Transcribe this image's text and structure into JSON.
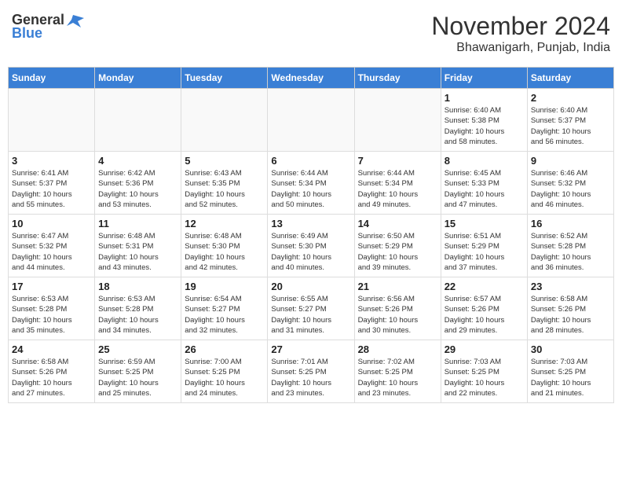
{
  "header": {
    "logo_general": "General",
    "logo_blue": "Blue",
    "month_title": "November 2024",
    "location": "Bhawanigarh, Punjab, India"
  },
  "weekdays": [
    "Sunday",
    "Monday",
    "Tuesday",
    "Wednesday",
    "Thursday",
    "Friday",
    "Saturday"
  ],
  "weeks": [
    [
      {
        "day": "",
        "info": ""
      },
      {
        "day": "",
        "info": ""
      },
      {
        "day": "",
        "info": ""
      },
      {
        "day": "",
        "info": ""
      },
      {
        "day": "",
        "info": ""
      },
      {
        "day": "1",
        "info": "Sunrise: 6:40 AM\nSunset: 5:38 PM\nDaylight: 10 hours\nand 58 minutes."
      },
      {
        "day": "2",
        "info": "Sunrise: 6:40 AM\nSunset: 5:37 PM\nDaylight: 10 hours\nand 56 minutes."
      }
    ],
    [
      {
        "day": "3",
        "info": "Sunrise: 6:41 AM\nSunset: 5:37 PM\nDaylight: 10 hours\nand 55 minutes."
      },
      {
        "day": "4",
        "info": "Sunrise: 6:42 AM\nSunset: 5:36 PM\nDaylight: 10 hours\nand 53 minutes."
      },
      {
        "day": "5",
        "info": "Sunrise: 6:43 AM\nSunset: 5:35 PM\nDaylight: 10 hours\nand 52 minutes."
      },
      {
        "day": "6",
        "info": "Sunrise: 6:44 AM\nSunset: 5:34 PM\nDaylight: 10 hours\nand 50 minutes."
      },
      {
        "day": "7",
        "info": "Sunrise: 6:44 AM\nSunset: 5:34 PM\nDaylight: 10 hours\nand 49 minutes."
      },
      {
        "day": "8",
        "info": "Sunrise: 6:45 AM\nSunset: 5:33 PM\nDaylight: 10 hours\nand 47 minutes."
      },
      {
        "day": "9",
        "info": "Sunrise: 6:46 AM\nSunset: 5:32 PM\nDaylight: 10 hours\nand 46 minutes."
      }
    ],
    [
      {
        "day": "10",
        "info": "Sunrise: 6:47 AM\nSunset: 5:32 PM\nDaylight: 10 hours\nand 44 minutes."
      },
      {
        "day": "11",
        "info": "Sunrise: 6:48 AM\nSunset: 5:31 PM\nDaylight: 10 hours\nand 43 minutes."
      },
      {
        "day": "12",
        "info": "Sunrise: 6:48 AM\nSunset: 5:30 PM\nDaylight: 10 hours\nand 42 minutes."
      },
      {
        "day": "13",
        "info": "Sunrise: 6:49 AM\nSunset: 5:30 PM\nDaylight: 10 hours\nand 40 minutes."
      },
      {
        "day": "14",
        "info": "Sunrise: 6:50 AM\nSunset: 5:29 PM\nDaylight: 10 hours\nand 39 minutes."
      },
      {
        "day": "15",
        "info": "Sunrise: 6:51 AM\nSunset: 5:29 PM\nDaylight: 10 hours\nand 37 minutes."
      },
      {
        "day": "16",
        "info": "Sunrise: 6:52 AM\nSunset: 5:28 PM\nDaylight: 10 hours\nand 36 minutes."
      }
    ],
    [
      {
        "day": "17",
        "info": "Sunrise: 6:53 AM\nSunset: 5:28 PM\nDaylight: 10 hours\nand 35 minutes."
      },
      {
        "day": "18",
        "info": "Sunrise: 6:53 AM\nSunset: 5:28 PM\nDaylight: 10 hours\nand 34 minutes."
      },
      {
        "day": "19",
        "info": "Sunrise: 6:54 AM\nSunset: 5:27 PM\nDaylight: 10 hours\nand 32 minutes."
      },
      {
        "day": "20",
        "info": "Sunrise: 6:55 AM\nSunset: 5:27 PM\nDaylight: 10 hours\nand 31 minutes."
      },
      {
        "day": "21",
        "info": "Sunrise: 6:56 AM\nSunset: 5:26 PM\nDaylight: 10 hours\nand 30 minutes."
      },
      {
        "day": "22",
        "info": "Sunrise: 6:57 AM\nSunset: 5:26 PM\nDaylight: 10 hours\nand 29 minutes."
      },
      {
        "day": "23",
        "info": "Sunrise: 6:58 AM\nSunset: 5:26 PM\nDaylight: 10 hours\nand 28 minutes."
      }
    ],
    [
      {
        "day": "24",
        "info": "Sunrise: 6:58 AM\nSunset: 5:26 PM\nDaylight: 10 hours\nand 27 minutes."
      },
      {
        "day": "25",
        "info": "Sunrise: 6:59 AM\nSunset: 5:25 PM\nDaylight: 10 hours\nand 25 minutes."
      },
      {
        "day": "26",
        "info": "Sunrise: 7:00 AM\nSunset: 5:25 PM\nDaylight: 10 hours\nand 24 minutes."
      },
      {
        "day": "27",
        "info": "Sunrise: 7:01 AM\nSunset: 5:25 PM\nDaylight: 10 hours\nand 23 minutes."
      },
      {
        "day": "28",
        "info": "Sunrise: 7:02 AM\nSunset: 5:25 PM\nDaylight: 10 hours\nand 23 minutes."
      },
      {
        "day": "29",
        "info": "Sunrise: 7:03 AM\nSunset: 5:25 PM\nDaylight: 10 hours\nand 22 minutes."
      },
      {
        "day": "30",
        "info": "Sunrise: 7:03 AM\nSunset: 5:25 PM\nDaylight: 10 hours\nand 21 minutes."
      }
    ]
  ]
}
